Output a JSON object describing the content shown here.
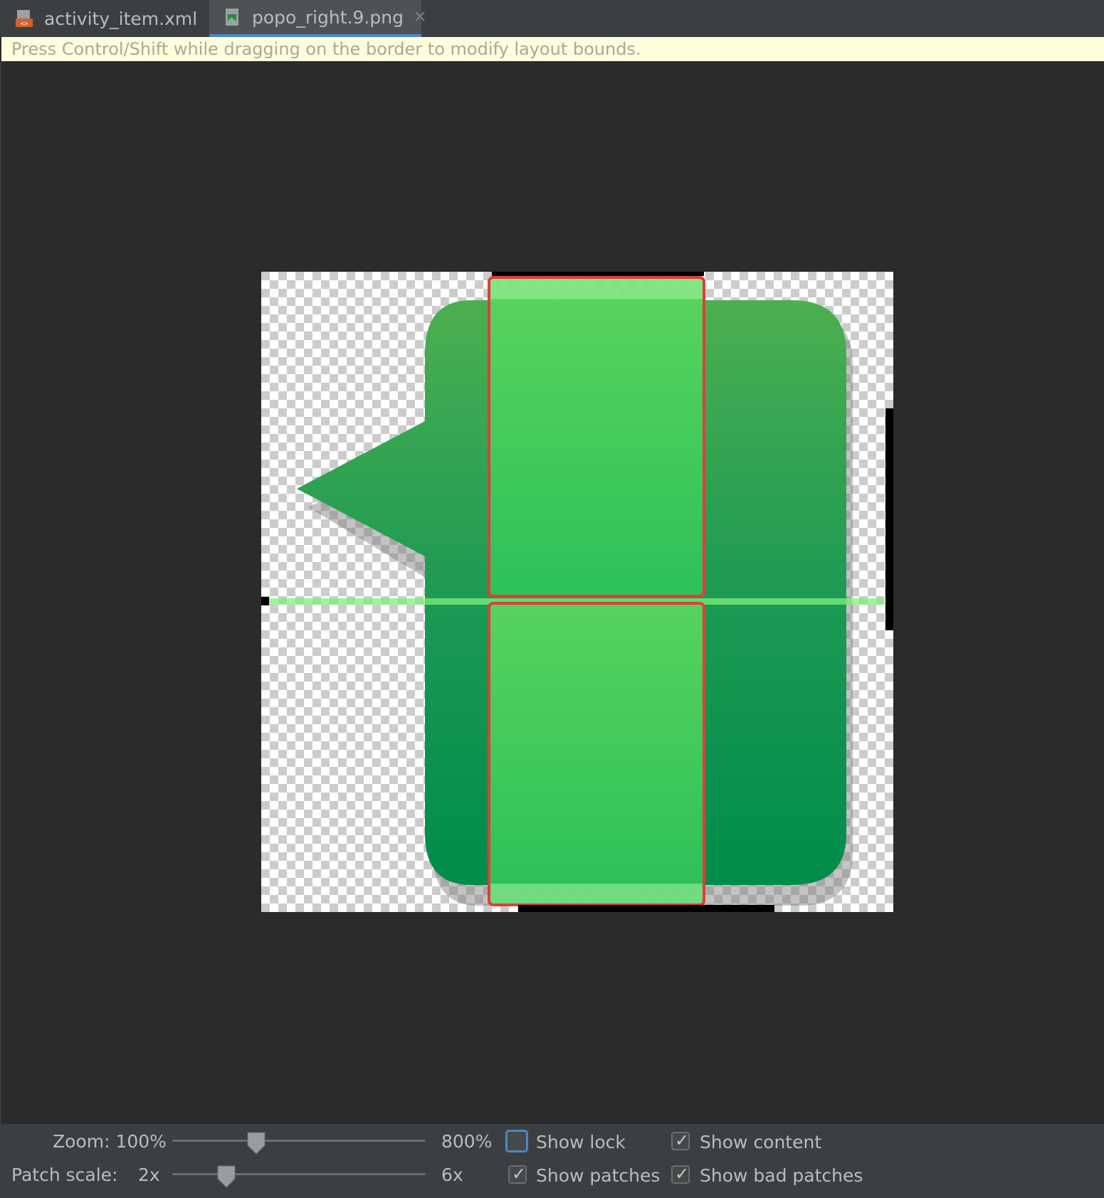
{
  "tabs": [
    {
      "label": "activity_item.xml",
      "icon": "xml-file-icon",
      "active": false
    },
    {
      "label": "popo_right.9.png",
      "icon": "image-file-icon",
      "active": true
    }
  ],
  "hint": "Press Control/Shift while dragging on the border to modify layout bounds.",
  "controls": {
    "zoom_label": "Zoom: 100%",
    "zoom_max": "800%",
    "patch_scale_label": "Patch scale:",
    "patch_scale_min": "2x",
    "patch_scale_max": "6x",
    "zoom_level": 0.33,
    "patch_scale_level": 0.21,
    "show_lock": {
      "label": "Show lock",
      "checked": false
    },
    "show_content": {
      "label": "Show content",
      "checked": true
    },
    "show_patches": {
      "label": "Show patches",
      "checked": true
    },
    "show_bad_patches": {
      "label": "Show bad patches",
      "checked": true
    }
  },
  "colors": {
    "patch_fill": "#4fd95a",
    "patch_border": "#e23c3c",
    "bubble_top": "#4caf50",
    "bubble_bottom": "#008c4a",
    "accent": "#4a88c7"
  }
}
